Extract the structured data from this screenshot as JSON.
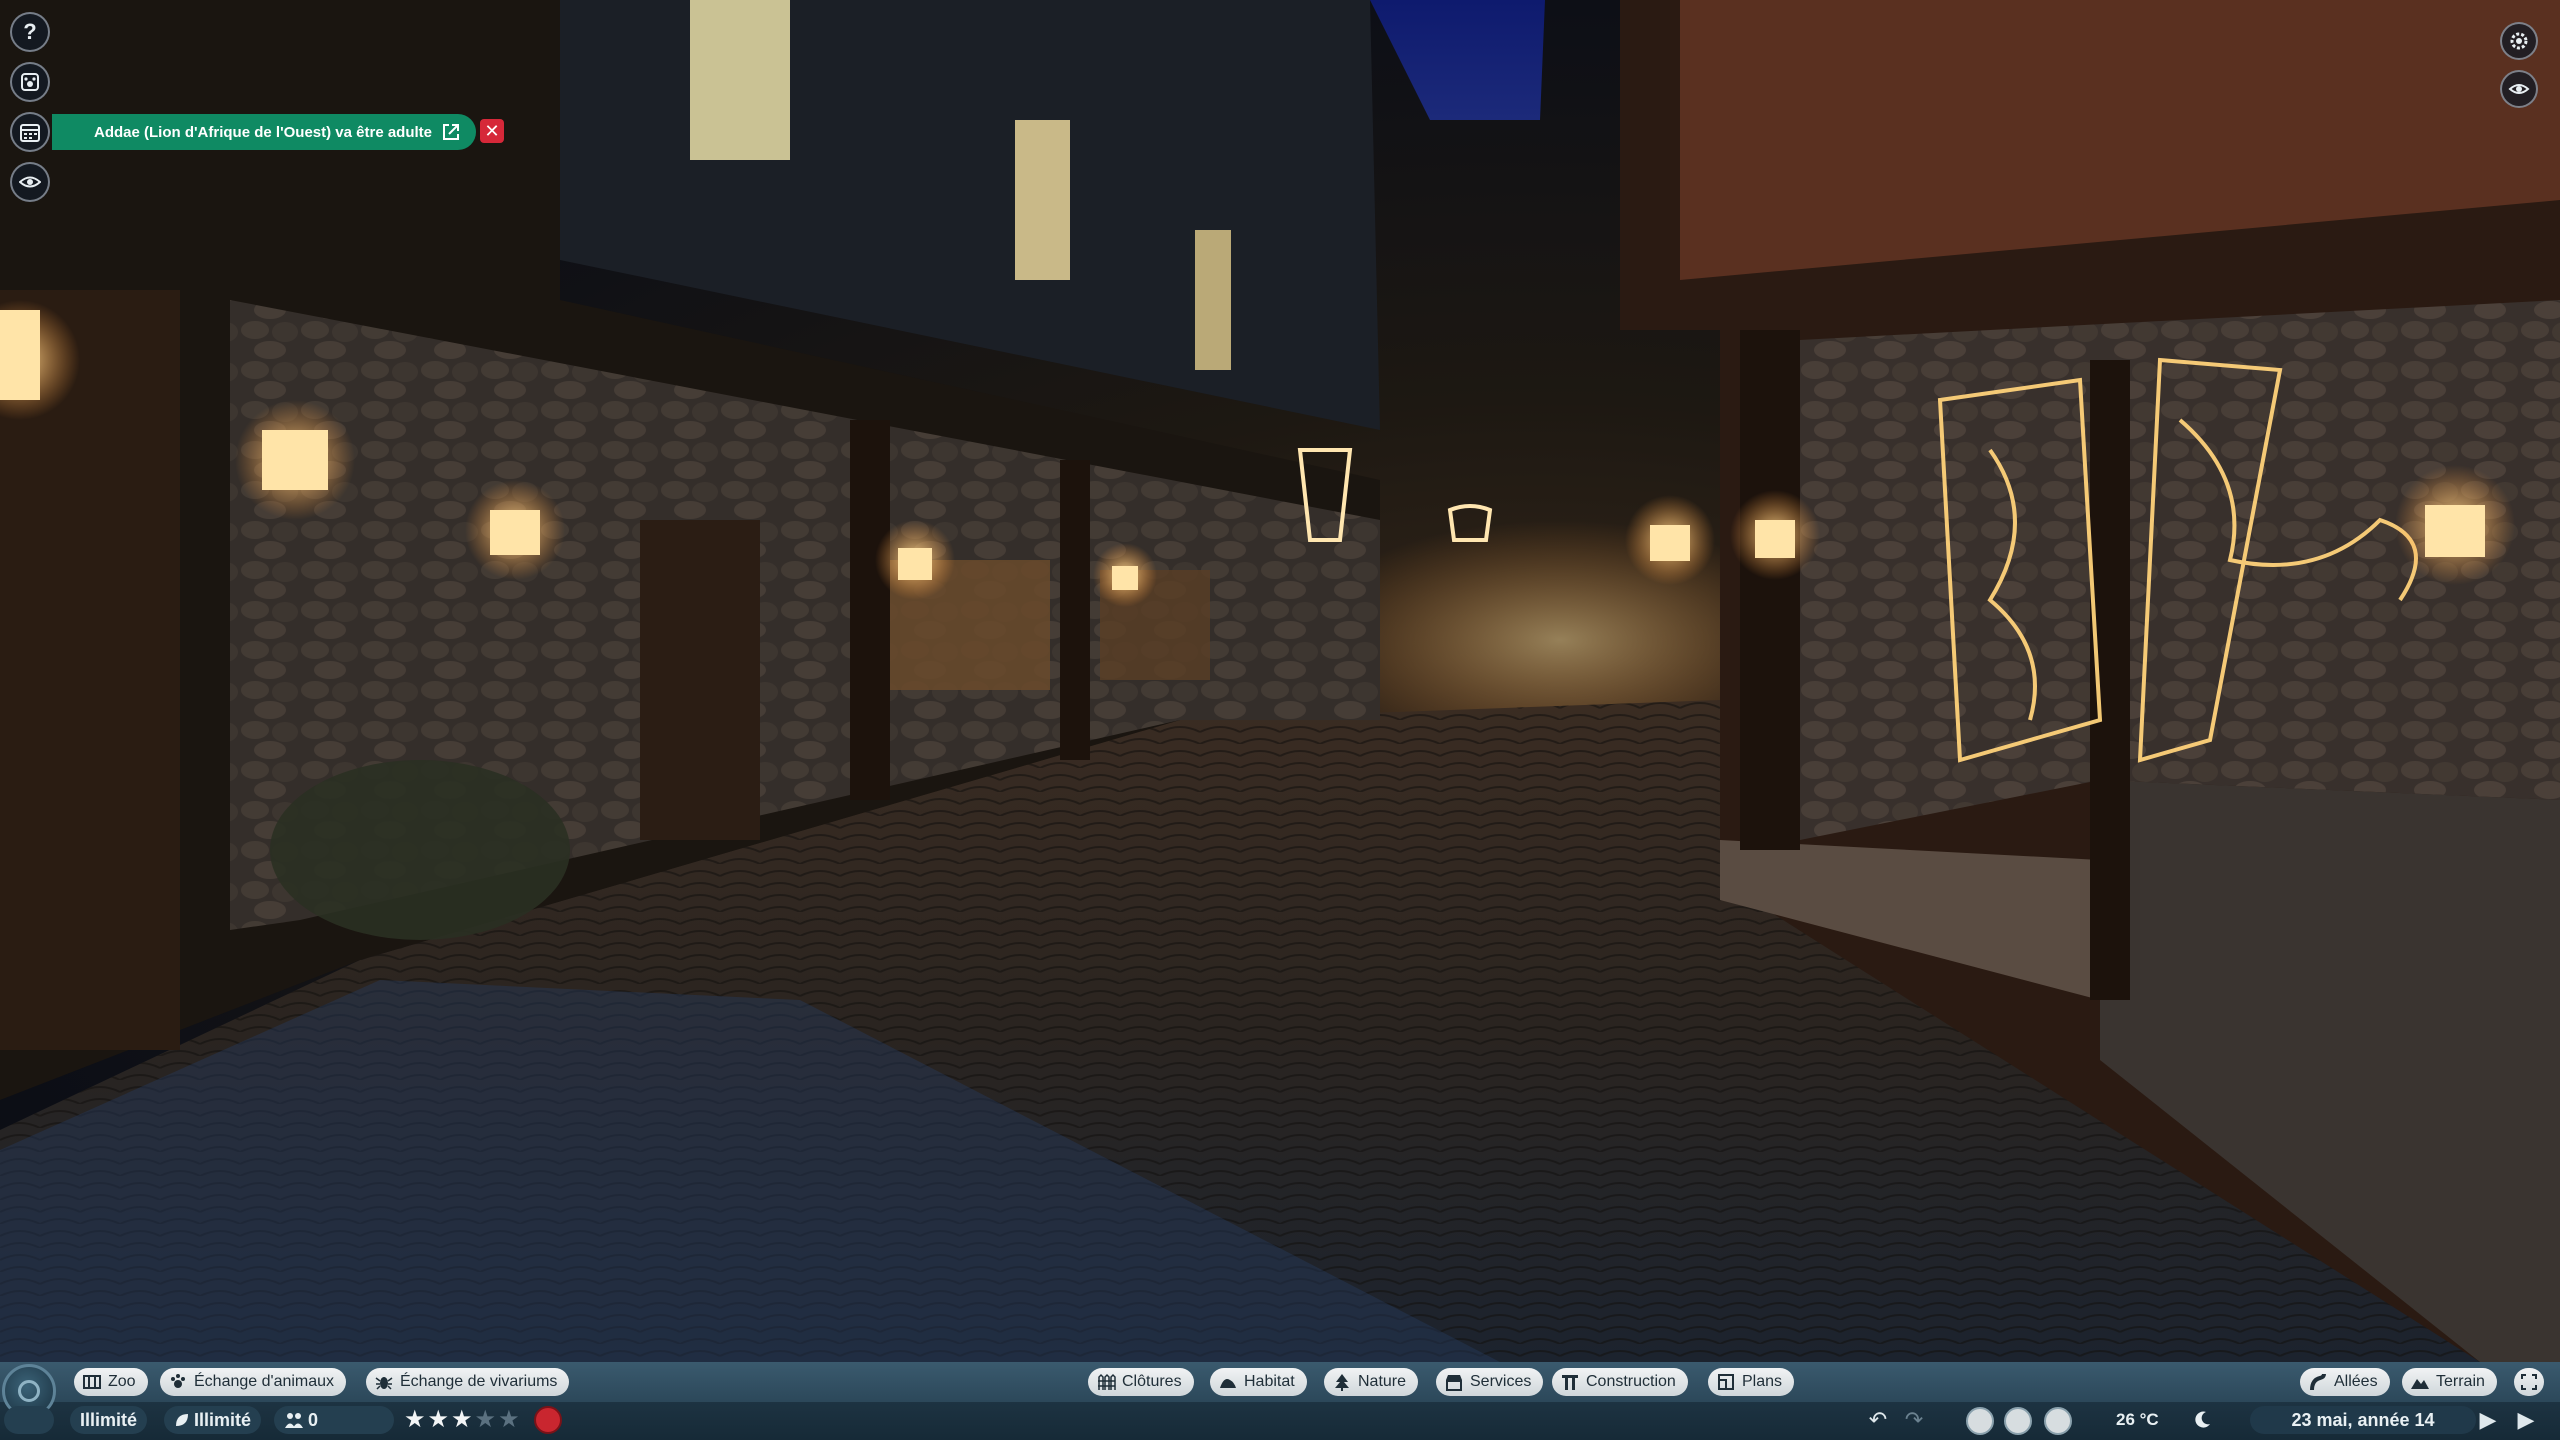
{
  "notification": {
    "message": "Addae (Lion d'Afrique de l'Ouest) va être adulte"
  },
  "hud_left": {
    "help_label": "?"
  },
  "bottom_left_tabs": [
    {
      "label": "Zoo",
      "icon": "zoo-icon"
    },
    {
      "label": "Échange d'animaux",
      "icon": "paw-icon"
    },
    {
      "label": "Échange de vivariums",
      "icon": "bug-icon"
    }
  ],
  "bottom_center_tabs": [
    {
      "label": "Clôtures",
      "icon": "fence-icon"
    },
    {
      "label": "Habitat",
      "icon": "habitat-icon"
    },
    {
      "label": "Nature",
      "icon": "tree-icon"
    },
    {
      "label": "Services",
      "icon": "shop-icon"
    },
    {
      "label": "Construction",
      "icon": "construction-icon"
    },
    {
      "label": "Plans",
      "icon": "blueprint-icon"
    }
  ],
  "bottom_right_tabs": [
    {
      "label": "Allées",
      "icon": "path-icon"
    },
    {
      "label": "Terrain",
      "icon": "terrain-icon"
    }
  ],
  "status": {
    "money": "Illimité",
    "research": "Illimité",
    "guests": "0",
    "rating_stars": 3,
    "rating_max": 5,
    "temperature": "26 °C",
    "date": "23 mai, année 14"
  },
  "colors": {
    "notification_bg": "#0f8a63",
    "close_bg": "#d62839",
    "bar_top": "#3a5a6e",
    "bar_bottom": "#1d3342",
    "star_on": "#f3f5f6",
    "star_off": "#5b7180"
  }
}
